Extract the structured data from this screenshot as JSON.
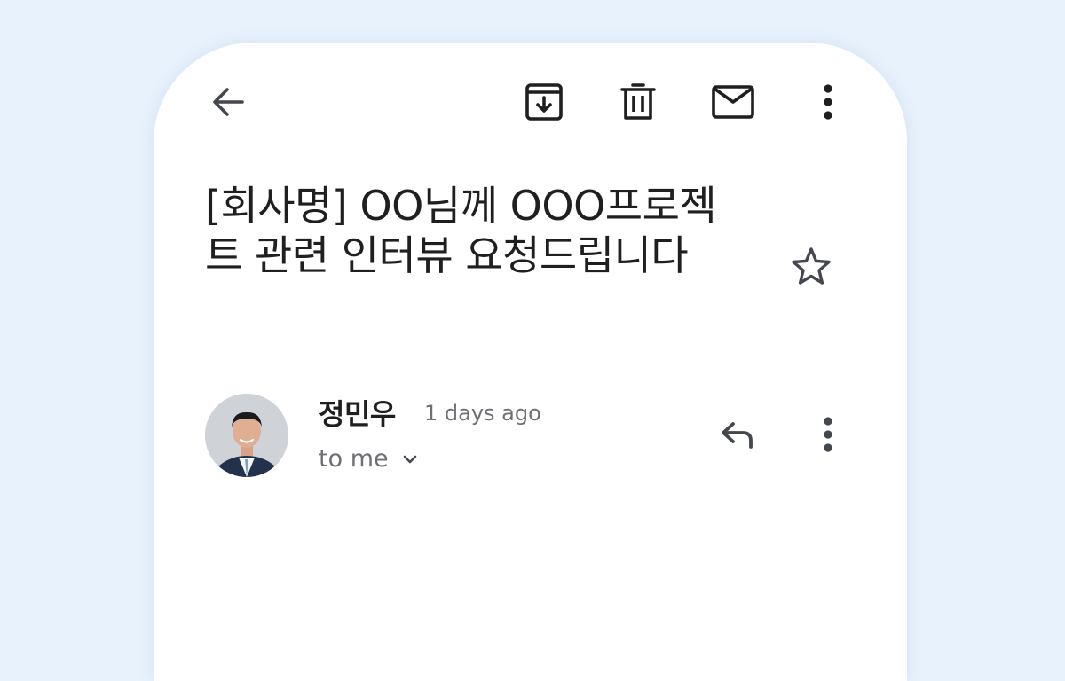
{
  "toolbar": {
    "back_icon": "arrow-left-icon",
    "archive_icon": "archive-icon",
    "delete_icon": "trash-icon",
    "mark_unread_icon": "mail-icon",
    "more_icon": "more-vert-icon"
  },
  "message": {
    "subject": "[회사명] OO님께 OOO프로젝트 관련 인터뷰 요청드립니다",
    "starred": false,
    "sender": {
      "name": "정민우",
      "time": "1 days ago",
      "recipient_label": "to me"
    }
  },
  "colors": {
    "page_bg": "#e8f2fd",
    "card_bg": "#ffffff",
    "icon": "#44474e",
    "primary_text": "#1f1f1f",
    "secondary_text": "#6f6f76"
  }
}
